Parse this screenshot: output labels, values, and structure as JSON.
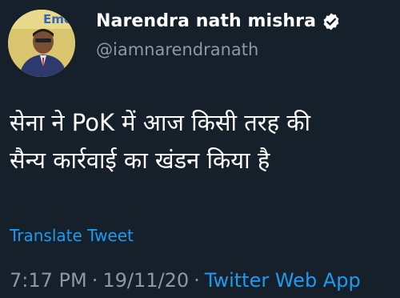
{
  "user": {
    "display_name": "Narendra nath mishra",
    "handle": "@iamnarendranath",
    "verified_icon": "verified-badge-icon",
    "avatar_banner_text": "Emer"
  },
  "tweet": {
    "text_lines": [
      "सेना ने PoK में आज किसी तरह की",
      "सैन्य कार्रवाई का खंडन किया है"
    ],
    "translate_label": "Translate Tweet",
    "time": "7:17 PM",
    "date": "19/11/20",
    "separator": "·",
    "source": "Twitter Web App"
  },
  "colors": {
    "background": "#15202b",
    "primary_text": "#ffffff",
    "secondary_text": "#8b98a5",
    "link": "#1d9bf0"
  }
}
